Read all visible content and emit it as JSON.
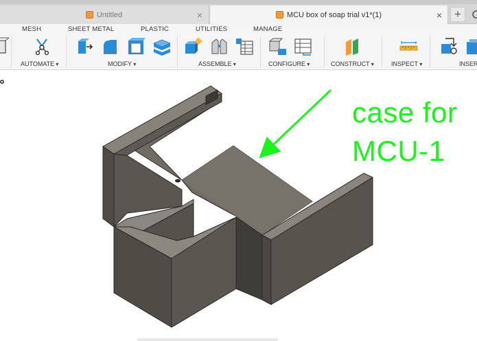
{
  "tabs": [
    {
      "title": "Untitled",
      "active": false
    },
    {
      "title": "MCU box of soap trial v1*(1)",
      "active": true
    }
  ],
  "tab_close_glyph": "×",
  "new_tab_glyph": "+",
  "toolbar": {
    "workspace_tabs": [
      "MESH",
      "SHEET METAL",
      "PLASTIC",
      "UTILITIES",
      "MANAGE"
    ],
    "groups": [
      "AUTOMATE",
      "MODIFY",
      "ASSEMBLE",
      "CONFIGURE",
      "CONSTRUCT",
      "INSPECT",
      "INSERT"
    ]
  },
  "annotation": {
    "line1": "case for",
    "line2": "MCU-1",
    "color": "#1cf21c"
  },
  "model": {
    "face_top_color": "#6e6a62",
    "face_left_color": "#5f5b54",
    "face_right_color": "#55524b",
    "edge_color": "#2a2825"
  },
  "colors": {
    "tabbar_bg": "#d6d6d6",
    "toolbar_bg": "#f5f5f5",
    "accent_blue": "#2b8bd9"
  }
}
